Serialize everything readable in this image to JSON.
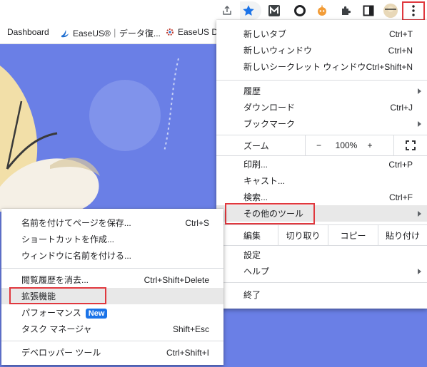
{
  "bookmarks": [
    {
      "label": "Dashboard"
    },
    {
      "label": "EaseUS®｜データ復..."
    },
    {
      "label": "EaseUS D"
    }
  ],
  "main_menu": {
    "items": [
      {
        "label": "新しいタブ",
        "shortcut": "Ctrl+T"
      },
      {
        "label": "新しいウィンドウ",
        "shortcut": "Ctrl+N"
      },
      {
        "label": "新しいシークレット ウィンドウ",
        "shortcut": "Ctrl+Shift+N"
      },
      {
        "label": "履歴",
        "shortcut": ""
      },
      {
        "label": "ダウンロード",
        "shortcut": "Ctrl+J"
      },
      {
        "label": "ブックマーク",
        "shortcut": ""
      },
      {
        "label": "印刷...",
        "shortcut": "Ctrl+P"
      },
      {
        "label": "キャスト...",
        "shortcut": ""
      },
      {
        "label": "検索...",
        "shortcut": "Ctrl+F"
      },
      {
        "label": "その他のツール",
        "shortcut": ""
      },
      {
        "label": "設定",
        "shortcut": ""
      },
      {
        "label": "ヘルプ",
        "shortcut": ""
      },
      {
        "label": "終了",
        "shortcut": ""
      }
    ],
    "zoom": {
      "label": "ズーム",
      "minus": "−",
      "value": "100%",
      "plus": "+"
    },
    "edit": {
      "label": "編集",
      "cut": "切り取り",
      "copy": "コピー",
      "paste": "貼り付け"
    }
  },
  "sub_menu": {
    "items": [
      {
        "label": "名前を付けてページを保存...",
        "shortcut": "Ctrl+S"
      },
      {
        "label": "ショートカットを作成...",
        "shortcut": ""
      },
      {
        "label": "ウィンドウに名前を付ける...",
        "shortcut": ""
      },
      {
        "label": "閲覧履歴を消去...",
        "shortcut": "Ctrl+Shift+Delete"
      },
      {
        "label": "拡張機能",
        "shortcut": ""
      },
      {
        "label": "パフォーマンス",
        "shortcut": "",
        "badge": "New"
      },
      {
        "label": "タスク マネージャ",
        "shortcut": "Shift+Esc"
      },
      {
        "label": "デベロッパー ツール",
        "shortcut": "Ctrl+Shift+I"
      }
    ]
  },
  "colors": {
    "highlight_box": "#e0383e",
    "page_bg": "#6a7fe6",
    "accent": "#1a73e8"
  }
}
